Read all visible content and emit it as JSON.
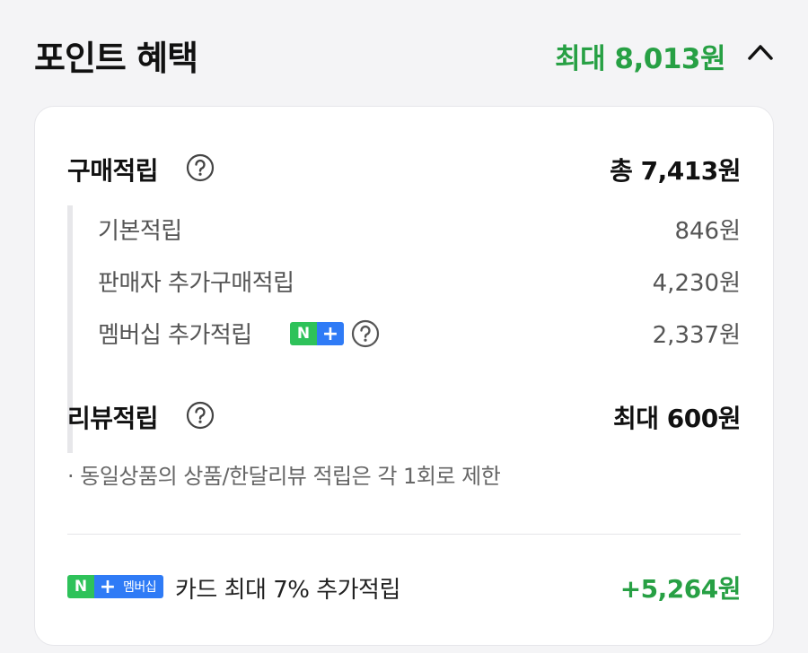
{
  "header": {
    "title": "포인트 혜택",
    "max_benefit": "최대 8,013원",
    "toggle_icon": "chevron-up-icon"
  },
  "purchase": {
    "title": "구매적립",
    "total": "총 7,413원",
    "help_icon": "question-circle-icon",
    "items": [
      {
        "label": "기본적립",
        "value": "846원"
      },
      {
        "label": "판매자 추가구매적립",
        "value": "4,230원"
      },
      {
        "label": "멤버십 추가적립",
        "value": "2,337원"
      }
    ]
  },
  "badge": {
    "n": "N",
    "plus": "+",
    "member": "멤버십"
  },
  "review": {
    "title": "리뷰적립",
    "value": "최대 600원",
    "note": "· 동일상품의 상품/한달리뷰 적립은 각 1회로 제한"
  },
  "card_promo": {
    "label": "카드 최대 7% 추가적립",
    "value": "+5,264원"
  },
  "colors": {
    "accent_green": "#27a044",
    "badge_green": "#2ec25a",
    "badge_blue": "#2f7bf6"
  }
}
